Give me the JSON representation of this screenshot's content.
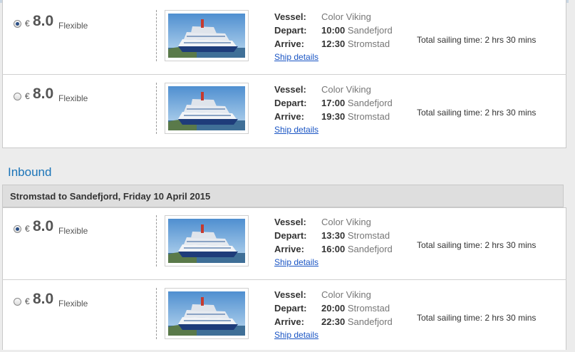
{
  "outbound": {
    "sailings": [
      {
        "selected": true,
        "currency": "€",
        "price": "8.0",
        "fare_type": "Flexible",
        "vessel_label": "Vessel:",
        "vessel": "Color Viking",
        "depart_label": "Depart:",
        "depart_time": "10:00",
        "depart_port": "Sandefjord",
        "arrive_label": "Arrive:",
        "arrive_time": "12:30",
        "arrive_port": "Stromstad",
        "details_link": "Ship details",
        "total": "Total sailing time: 2 hrs 30 mins"
      },
      {
        "selected": false,
        "currency": "€",
        "price": "8.0",
        "fare_type": "Flexible",
        "vessel_label": "Vessel:",
        "vessel": "Color Viking",
        "depart_label": "Depart:",
        "depart_time": "17:00",
        "depart_port": "Sandefjord",
        "arrive_label": "Arrive:",
        "arrive_time": "19:30",
        "arrive_port": "Stromstad",
        "details_link": "Ship details",
        "total": "Total sailing time: 2 hrs 30 mins"
      }
    ]
  },
  "inbound": {
    "title": "Inbound",
    "route": "Stromstad to Sandefjord,  Friday 10 April 2015",
    "sailings": [
      {
        "selected": true,
        "currency": "€",
        "price": "8.0",
        "fare_type": "Flexible",
        "vessel_label": "Vessel:",
        "vessel": "Color Viking",
        "depart_label": "Depart:",
        "depart_time": "13:30",
        "depart_port": "Stromstad",
        "arrive_label": "Arrive:",
        "arrive_time": "16:00",
        "arrive_port": "Sandefjord",
        "details_link": "Ship details",
        "total": "Total sailing time: 2 hrs 30 mins"
      },
      {
        "selected": false,
        "currency": "€",
        "price": "8.0",
        "fare_type": "Flexible",
        "vessel_label": "Vessel:",
        "vessel": "Color Viking",
        "depart_label": "Depart:",
        "depart_time": "20:00",
        "depart_port": "Stromstad",
        "arrive_label": "Arrive:",
        "arrive_time": "22:30",
        "arrive_port": "Sandefjord",
        "details_link": "Ship details",
        "total": "Total sailing time: 2 hrs 30 mins"
      }
    ]
  },
  "colors": {
    "accent": "#1a74b8",
    "link": "#1a55c4",
    "route_bar": "#dedede"
  }
}
